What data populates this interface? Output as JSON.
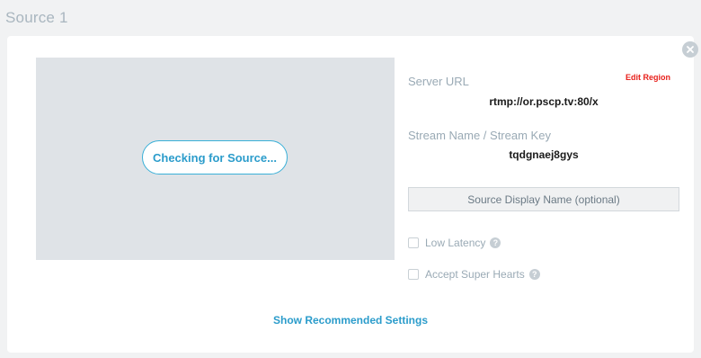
{
  "header": {
    "title": "Source 1"
  },
  "preview": {
    "button_label": "Checking for Source..."
  },
  "server": {
    "label": "Server URL",
    "edit_region": "Edit Region",
    "url": "rtmp://or.pscp.tv:80/x"
  },
  "stream": {
    "label": "Stream Name / Stream Key",
    "key": "tqdgnaej8gys"
  },
  "display_name": {
    "placeholder": "Source Display Name (optional)"
  },
  "options": [
    {
      "label": "Low Latency",
      "checked": false,
      "help_icon": "question-icon"
    },
    {
      "label": "Accept Super Hearts",
      "checked": false,
      "help_icon": "question-icon"
    }
  ],
  "footer": {
    "link": "Show Recommended Settings"
  },
  "colors": {
    "accent": "#2b9ccb",
    "danger": "#e8201b",
    "preview_bg": "#dfe3e7"
  }
}
